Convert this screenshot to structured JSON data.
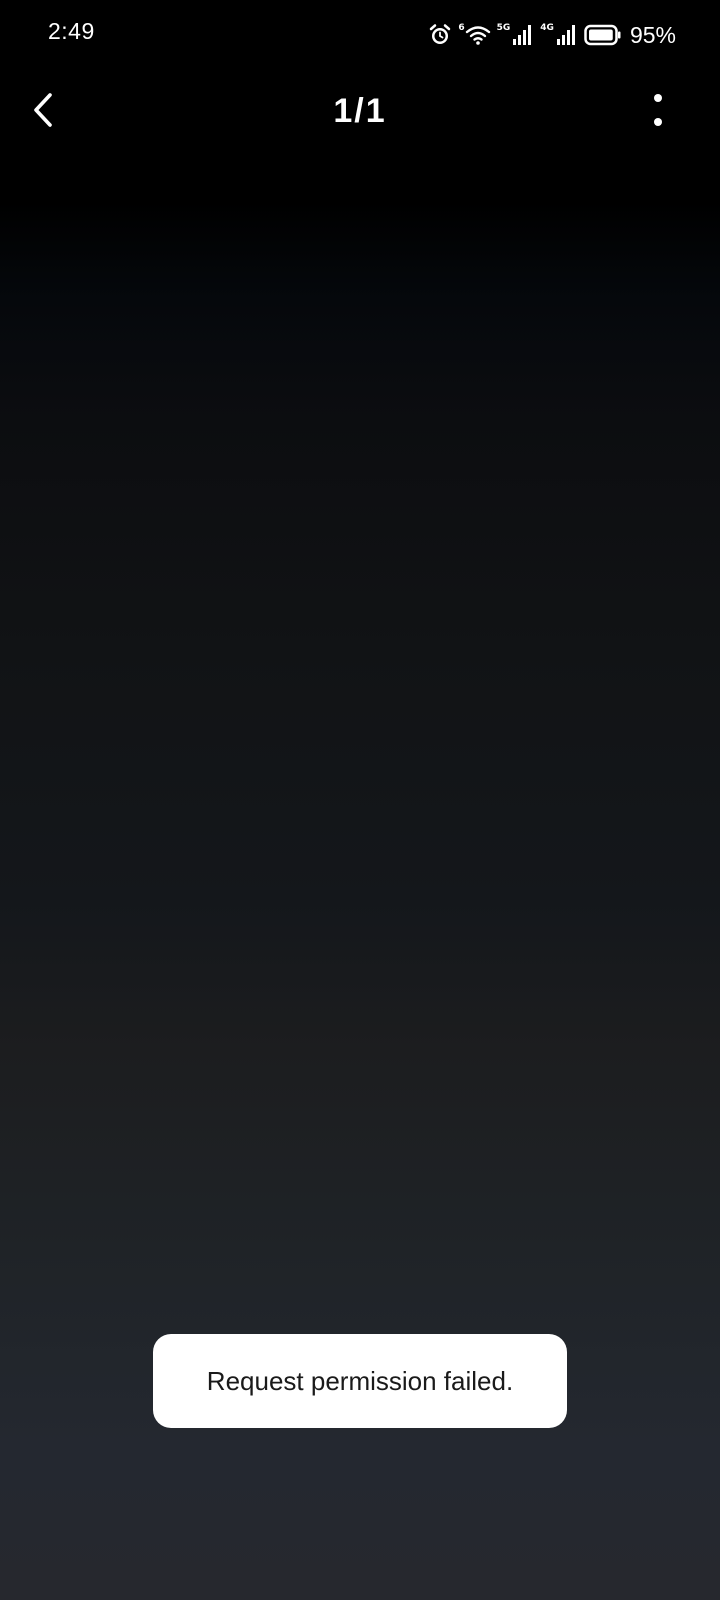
{
  "status_bar": {
    "time": "2:49",
    "wifi_tag": "6",
    "net1_tag": "5G",
    "net2_tag": "4G",
    "battery_percent": "95%",
    "battery_level": 0.95,
    "icons": [
      "alarm-icon",
      "wifi-icon",
      "signal-5g-icon",
      "signal-4g-icon",
      "battery-icon"
    ]
  },
  "top_bar": {
    "back_icon": "chevron-left-icon",
    "page_counter": "1/1",
    "more_icon": "more-vertical-icon"
  },
  "toast": {
    "message": "Request permission failed."
  },
  "colors": {
    "background_top": "#000000",
    "background_bottom": "#26282e",
    "toast_bg": "#ffffff",
    "toast_text": "#1a1a1a"
  }
}
